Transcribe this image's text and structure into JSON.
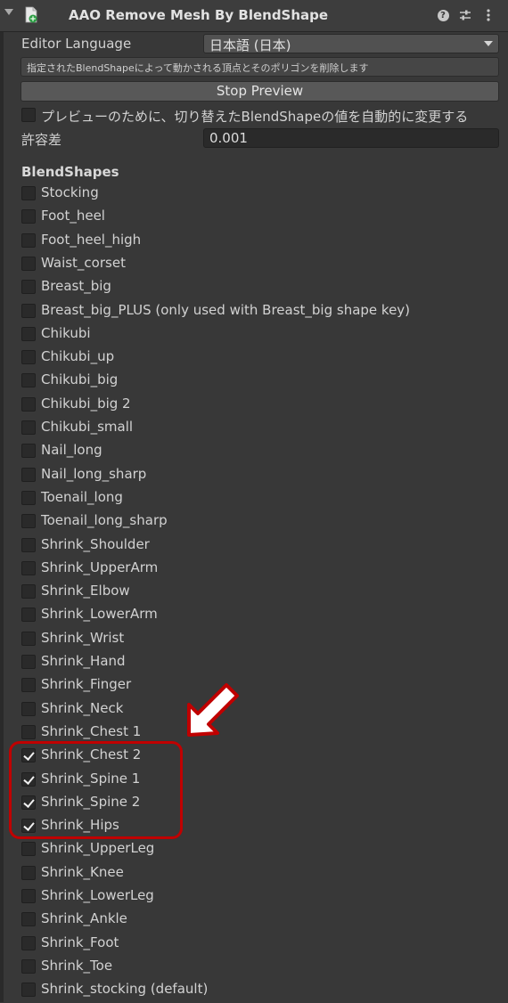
{
  "header": {
    "title": "AAO Remove Mesh By BlendShape",
    "icons": [
      "fold-arrow-icon",
      "script-icon",
      "help-icon",
      "presets-icon",
      "more-icon"
    ]
  },
  "editor_language": {
    "label": "Editor Language",
    "value": "日本語 (日本)"
  },
  "helpbox": {
    "text": "指定されたBlendShapeによって動かされる頂点とそのポリゴンを削除します"
  },
  "stop_preview_button": {
    "label": "Stop Preview"
  },
  "auto_change": {
    "label": "プレビューのために、切り替えたBlendShapeの値を自動的に変更する",
    "checked": false
  },
  "tolerance": {
    "label": "許容差",
    "value": "0.001"
  },
  "blendshapes": {
    "title": "BlendShapes",
    "items": [
      {
        "label": "Stocking",
        "checked": false
      },
      {
        "label": "Foot_heel",
        "checked": false
      },
      {
        "label": "Foot_heel_high",
        "checked": false
      },
      {
        "label": "Waist_corset",
        "checked": false
      },
      {
        "label": "Breast_big",
        "checked": false
      },
      {
        "label": "Breast_big_PLUS (only used with Breast_big shape key)",
        "checked": false
      },
      {
        "label": "Chikubi",
        "checked": false
      },
      {
        "label": "Chikubi_up",
        "checked": false
      },
      {
        "label": "Chikubi_big",
        "checked": false
      },
      {
        "label": "Chikubi_big 2",
        "checked": false
      },
      {
        "label": "Chikubi_small",
        "checked": false
      },
      {
        "label": "Nail_long",
        "checked": false
      },
      {
        "label": "Nail_long_sharp",
        "checked": false
      },
      {
        "label": "Toenail_long",
        "checked": false
      },
      {
        "label": "Toenail_long_sharp",
        "checked": false
      },
      {
        "label": "Shrink_Shoulder",
        "checked": false
      },
      {
        "label": "Shrink_UpperArm",
        "checked": false
      },
      {
        "label": "Shrink_Elbow",
        "checked": false
      },
      {
        "label": "Shrink_LowerArm",
        "checked": false
      },
      {
        "label": "Shrink_Wrist",
        "checked": false
      },
      {
        "label": "Shrink_Hand",
        "checked": false
      },
      {
        "label": "Shrink_Finger",
        "checked": false
      },
      {
        "label": "Shrink_Neck",
        "checked": false
      },
      {
        "label": "Shrink_Chest 1",
        "checked": false
      },
      {
        "label": "Shrink_Chest 2",
        "checked": true
      },
      {
        "label": "Shrink_Spine 1",
        "checked": true
      },
      {
        "label": "Shrink_Spine 2",
        "checked": true
      },
      {
        "label": "Shrink_Hips",
        "checked": true
      },
      {
        "label": "Shrink_UpperLeg",
        "checked": false
      },
      {
        "label": "Shrink_Knee",
        "checked": false
      },
      {
        "label": "Shrink_LowerLeg",
        "checked": false
      },
      {
        "label": "Shrink_Ankle",
        "checked": false
      },
      {
        "label": "Shrink_Foot",
        "checked": false
      },
      {
        "label": "Shrink_Toe",
        "checked": false
      },
      {
        "label": "Shrink_stocking (default)",
        "checked": false
      }
    ]
  },
  "annotation": {
    "highlight_color": "#c00000",
    "arrow_color": "#ffffff",
    "arrow_outline_color": "#c00000"
  }
}
